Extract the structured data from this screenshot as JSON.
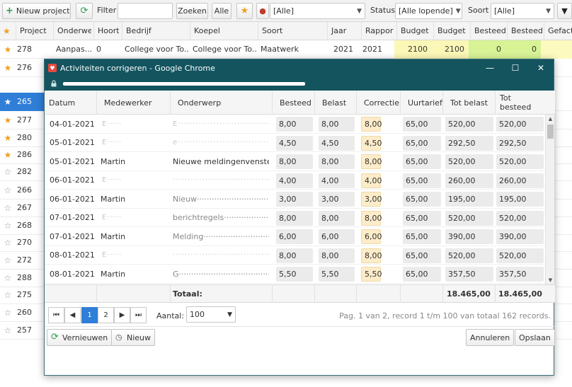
{
  "toolbar": {
    "new_project": "Nieuw project",
    "filter_label": "Filter",
    "filter_value": "",
    "search_button": "Zoeken",
    "all_button": "Alle",
    "person_value": "[Alle]",
    "status_label": "Status",
    "status_value": "[Alle lopende]",
    "sort_label": "Soort",
    "sort_value": "[Alle]"
  },
  "grid": {
    "headers": [
      "Project",
      "Onderwe",
      "Hoort",
      "Bedrijf",
      "Koepel",
      "Soort",
      "Jaar",
      "Rappor",
      "Budget p",
      "Budget l",
      "Besteed",
      "Besteed",
      "Gefact."
    ],
    "rows": [
      {
        "star": "★",
        "starred": true,
        "id": "278",
        "onderwerp": "Aanpas...",
        "hoort": "0",
        "bedrijf": "College voor To...",
        "koepel": "College voor To...",
        "soort": "Maatwerk",
        "jaar": "2021",
        "rapport": "2021",
        "budget_p": "2100",
        "budget_l": "2100",
        "besteed1": "0",
        "besteed2": "0"
      },
      {
        "star": "★",
        "starred": true,
        "id": "276"
      },
      {
        "star": "★",
        "starred": true,
        "id": "265",
        "selected": true
      },
      {
        "star": "★",
        "starred": true,
        "id": "277"
      },
      {
        "star": "★",
        "starred": true,
        "id": "280"
      },
      {
        "star": "★",
        "starred": true,
        "id": "286"
      },
      {
        "star": "☆",
        "starred": false,
        "id": "282"
      },
      {
        "star": "☆",
        "starred": false,
        "id": "266"
      },
      {
        "star": "☆",
        "starred": false,
        "id": "267"
      },
      {
        "star": "☆",
        "starred": false,
        "id": "268"
      },
      {
        "star": "☆",
        "starred": false,
        "id": "270"
      },
      {
        "star": "☆",
        "starred": false,
        "id": "272"
      },
      {
        "star": "☆",
        "starred": false,
        "id": "288"
      },
      {
        "star": "☆",
        "starred": false,
        "id": "275"
      },
      {
        "star": "☆",
        "starred": false,
        "id": "260"
      },
      {
        "star": "☆",
        "starred": false,
        "id": "257"
      }
    ]
  },
  "dialog": {
    "title": "Activiteiten corrigeren - Google Chrome",
    "headers": {
      "datum": "Datum",
      "medewerker": "Medewerker",
      "onderwerp": "Onderwerp",
      "besteed": "Besteed",
      "belast": "Belast",
      "correctie": "Correctie",
      "uurtarief": "Uurtarief",
      "tot_belast": "Tot belast",
      "tot_besteed": "Tot besteed"
    },
    "rows": [
      {
        "datum": "04-01-2021",
        "medewerker": "E·····",
        "onderwerp": "E·····································",
        "besteed": "8,00",
        "belast": "8,00",
        "correctie": "8,00",
        "uurtarief": "65,00",
        "tot_belast": "520,00",
        "tot_besteed": "520,00"
      },
      {
        "datum": "05-01-2021",
        "medewerker": "E·····",
        "onderwerp": "e·····································",
        "besteed": "4,50",
        "belast": "4,50",
        "correctie": "4,50",
        "uurtarief": "65,00",
        "tot_belast": "292,50",
        "tot_besteed": "292,50"
      },
      {
        "datum": "05-01-2021",
        "medewerker": "Martin",
        "onderwerp": "Nieuwe meldingenvenster",
        "besteed": "8,00",
        "belast": "8,00",
        "correctie": "8,00",
        "uurtarief": "65,00",
        "tot_belast": "520,00",
        "tot_besteed": "520,00"
      },
      {
        "datum": "06-01-2021",
        "medewerker": "E·····",
        "onderwerp": "······································",
        "besteed": "4,00",
        "belast": "4,00",
        "correctie": "4,00",
        "uurtarief": "65,00",
        "tot_belast": "260,00",
        "tot_besteed": "260,00"
      },
      {
        "datum": "06-01-2021",
        "medewerker": "Martin",
        "onderwerp": "Nieuw··································",
        "besteed": "3,00",
        "belast": "3,00",
        "correctie": "3,00",
        "uurtarief": "65,00",
        "tot_belast": "195,00",
        "tot_besteed": "195,00"
      },
      {
        "datum": "07-01-2021",
        "medewerker": "E·····",
        "onderwerp": "berichtregels·························",
        "besteed": "8,00",
        "belast": "8,00",
        "correctie": "8,00",
        "uurtarief": "65,00",
        "tot_belast": "520,00",
        "tot_besteed": "520,00"
      },
      {
        "datum": "07-01-2021",
        "medewerker": "Martin",
        "onderwerp": "Melding································",
        "besteed": "6,00",
        "belast": "6,00",
        "correctie": "6,00",
        "uurtarief": "65,00",
        "tot_belast": "390,00",
        "tot_besteed": "390,00"
      },
      {
        "datum": "08-01-2021",
        "medewerker": "E·····",
        "onderwerp": "······································",
        "besteed": "8,00",
        "belast": "8,00",
        "correctie": "8,00",
        "uurtarief": "65,00",
        "tot_belast": "520,00",
        "tot_besteed": "520,00"
      },
      {
        "datum": "08-01-2021",
        "medewerker": "Martin",
        "onderwerp": "G·····································",
        "besteed": "5,50",
        "belast": "5,50",
        "correctie": "5,50",
        "uurtarief": "65,00",
        "tot_belast": "357,50",
        "tot_besteed": "357,50"
      }
    ],
    "footer": {
      "total_label": "Totaal:",
      "tot_belast": "18.465,00",
      "tot_besteed": "18.465,00"
    },
    "pager": {
      "first": "⏮",
      "prev": "◀",
      "page1": "1",
      "page2": "2",
      "next": "▶",
      "last": "⏭",
      "amount_label": "Aantal:",
      "amount_value": "100",
      "info": "Pag. 1 van 2, record 1 t/m 100 van totaal 162 records."
    },
    "actions": {
      "refresh": "Vernieuwen",
      "new": "Nieuw",
      "cancel": "Annuleren",
      "save": "Opslaan"
    }
  },
  "colors": {
    "star": "#f0a020",
    "selected": "#2f7ed8",
    "titlebar": "#13545f",
    "refresh_icon": "#2e9b4a",
    "new_icon": "#2e9b4a"
  }
}
